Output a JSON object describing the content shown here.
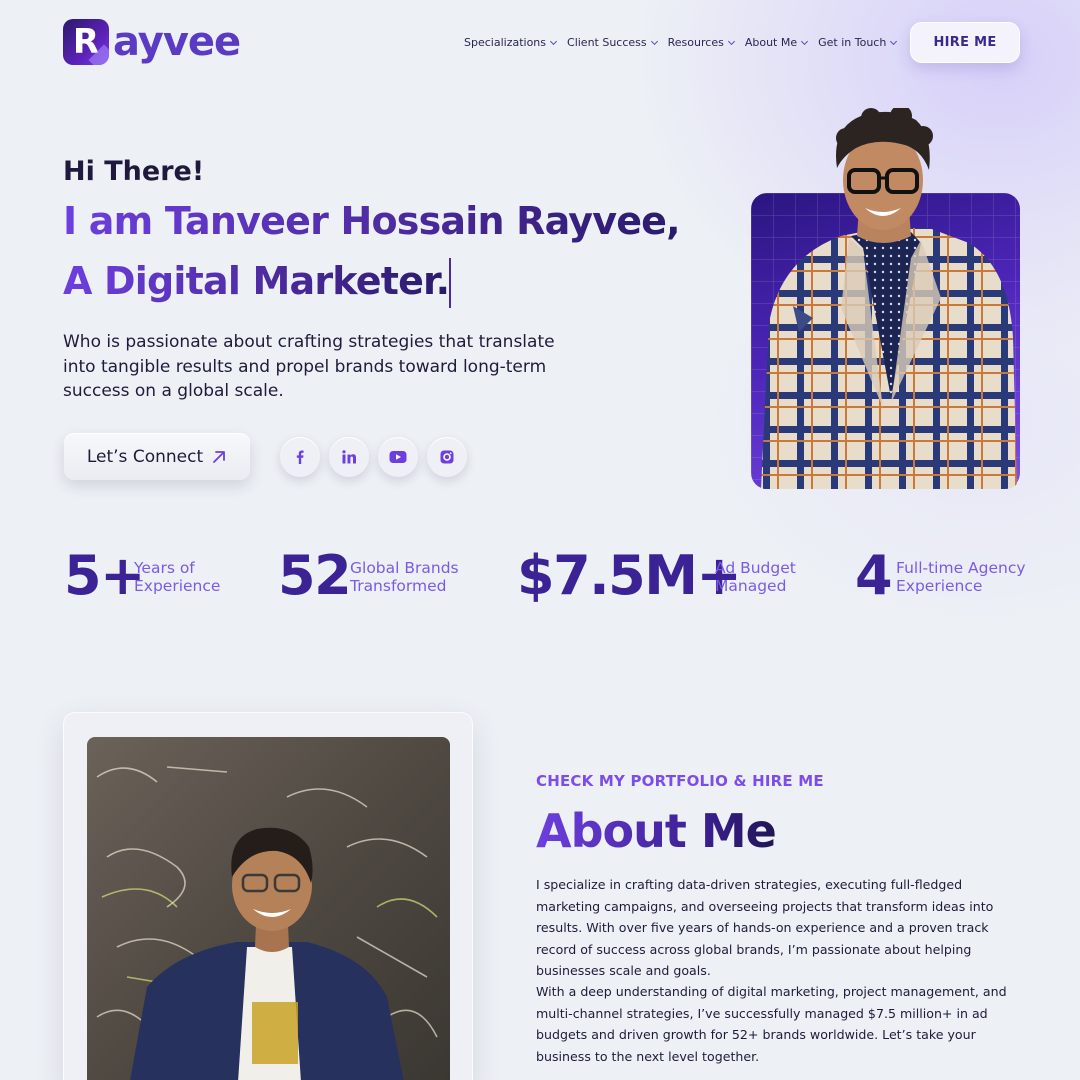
{
  "brand": {
    "logo_letter": "R",
    "logo_text": "ayvee"
  },
  "nav": {
    "items": [
      {
        "label": "Specializations"
      },
      {
        "label": "Client Success"
      },
      {
        "label": "Resources"
      },
      {
        "label": "About Me"
      },
      {
        "label": "Get in Touch"
      }
    ],
    "hire_label": "HIRE ME"
  },
  "hero": {
    "greeting": "Hi There!",
    "line1": "I am Tanveer Hossain Rayvee,",
    "line2": "A Digital Marketer.",
    "description": "Who is passionate about crafting strategies that translate into tangible results and propel brands toward long-term success on a global scale.",
    "cta_label": "Let’s Connect",
    "socials": [
      "facebook-icon",
      "linkedin-icon",
      "youtube-icon",
      "instagram-icon"
    ]
  },
  "stats": [
    {
      "value": "5+",
      "label1": "Years of",
      "label2": "Experience"
    },
    {
      "value": "52",
      "label1": "Global Brands",
      "label2": "Transformed"
    },
    {
      "value": "$7.5M+",
      "label1": "Ad Budget",
      "label2": "Managed"
    },
    {
      "value": "4",
      "label1": "Full-time Agency",
      "label2": "Experience"
    }
  ],
  "about": {
    "kicker": "CHECK MY PORTFOLIO & HIRE ME",
    "title": "About Me",
    "p1": "I specialize in crafting data-driven strategies, executing full-fledged marketing campaigns, and overseeing projects that transform ideas into results. With over five years of hands-on experience and a proven track record of success across global brands, I’m passionate about helping businesses scale and goals.",
    "p2": "With a deep understanding of digital marketing, project management, and multi-channel strategies, I’ve successfully managed $7.5 million+ in ad budgets and driven growth for 52+ brands worldwide. Let’s take your business to the next level together."
  },
  "colors": {
    "accent": "#7c4dea",
    "deep": "#3b2396",
    "bg": "#edf0f5"
  }
}
